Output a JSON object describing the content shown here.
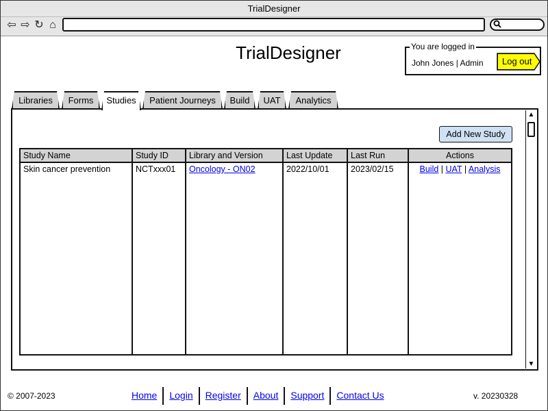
{
  "window": {
    "title": "TrialDesigner"
  },
  "browser": {
    "back_icon": "back-arrow-icon",
    "forward_icon": "forward-arrow-icon",
    "reload_icon": "reload-icon",
    "home_icon": "home-icon",
    "url_value": "",
    "search_icon": "search-icon"
  },
  "header": {
    "app_title": "TrialDesigner",
    "login_legend": "You are logged in",
    "user": "John Jones | Admin",
    "logout_label": "Log out"
  },
  "tabs": [
    {
      "label": "Libraries",
      "active": false
    },
    {
      "label": "Forms",
      "active": false
    },
    {
      "label": "Studies",
      "active": true
    },
    {
      "label": "Patient Journeys",
      "active": false
    },
    {
      "label": "Build",
      "active": false
    },
    {
      "label": "UAT",
      "active": false
    },
    {
      "label": "Analytics",
      "active": false
    }
  ],
  "studies": {
    "add_button": "Add New Study",
    "columns": [
      "Study Name",
      "Study ID",
      "Library and Version",
      "Last Update",
      "Last Run",
      "Actions"
    ],
    "rows": [
      {
        "study_name": "Skin cancer prevention",
        "study_id": "NCTxxx01",
        "library": "Oncology - ON02",
        "last_update": "2022/10/01",
        "last_run": "2023/02/15",
        "actions": [
          "Build",
          "UAT",
          "Analysis"
        ]
      }
    ],
    "action_separator": "|"
  },
  "footer": {
    "copyright": "© 2007-2023",
    "links": [
      "Home",
      "Login",
      "Register",
      "About",
      "Support",
      "Contact Us"
    ],
    "version": "v. 20230328"
  },
  "colors": {
    "logout_bg": "#ffff00",
    "add_button_bg": "#cfe2f3",
    "tab_bg": "#d3d3d3",
    "header_bg": "#d3d3d3",
    "link": "#0000ee"
  }
}
